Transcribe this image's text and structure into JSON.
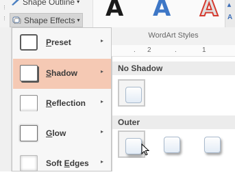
{
  "ribbon": {
    "shape_outline_label": "Shape Outline",
    "shape_effects_label": "Shape Effects",
    "dropdown_arrow": "▾",
    "wordart_letters": [
      "A",
      "A",
      "A"
    ],
    "side_glyph": "A"
  },
  "wordart_group": {
    "label": "WordArt Styles"
  },
  "ruler": {
    "marks": [
      ".",
      "2",
      ".",
      "1"
    ]
  },
  "menu": {
    "items": [
      {
        "label": "Preset",
        "arrow": "▸"
      },
      {
        "label": "Shadow",
        "arrow": "▸"
      },
      {
        "label": "Reflection",
        "arrow": "▸"
      },
      {
        "label": "Glow",
        "arrow": "▸"
      },
      {
        "label": "Soft Edges",
        "arrow": "▸"
      }
    ],
    "active_item": "Shadow"
  },
  "shadow_gallery": {
    "sections": [
      {
        "heading": "No Shadow"
      },
      {
        "heading": "Outer"
      }
    ]
  },
  "colors": {
    "active_item_bg": "#f5c9b4",
    "wordart_blue": "#3e77c6",
    "wordart_red": "#d53a2f"
  }
}
